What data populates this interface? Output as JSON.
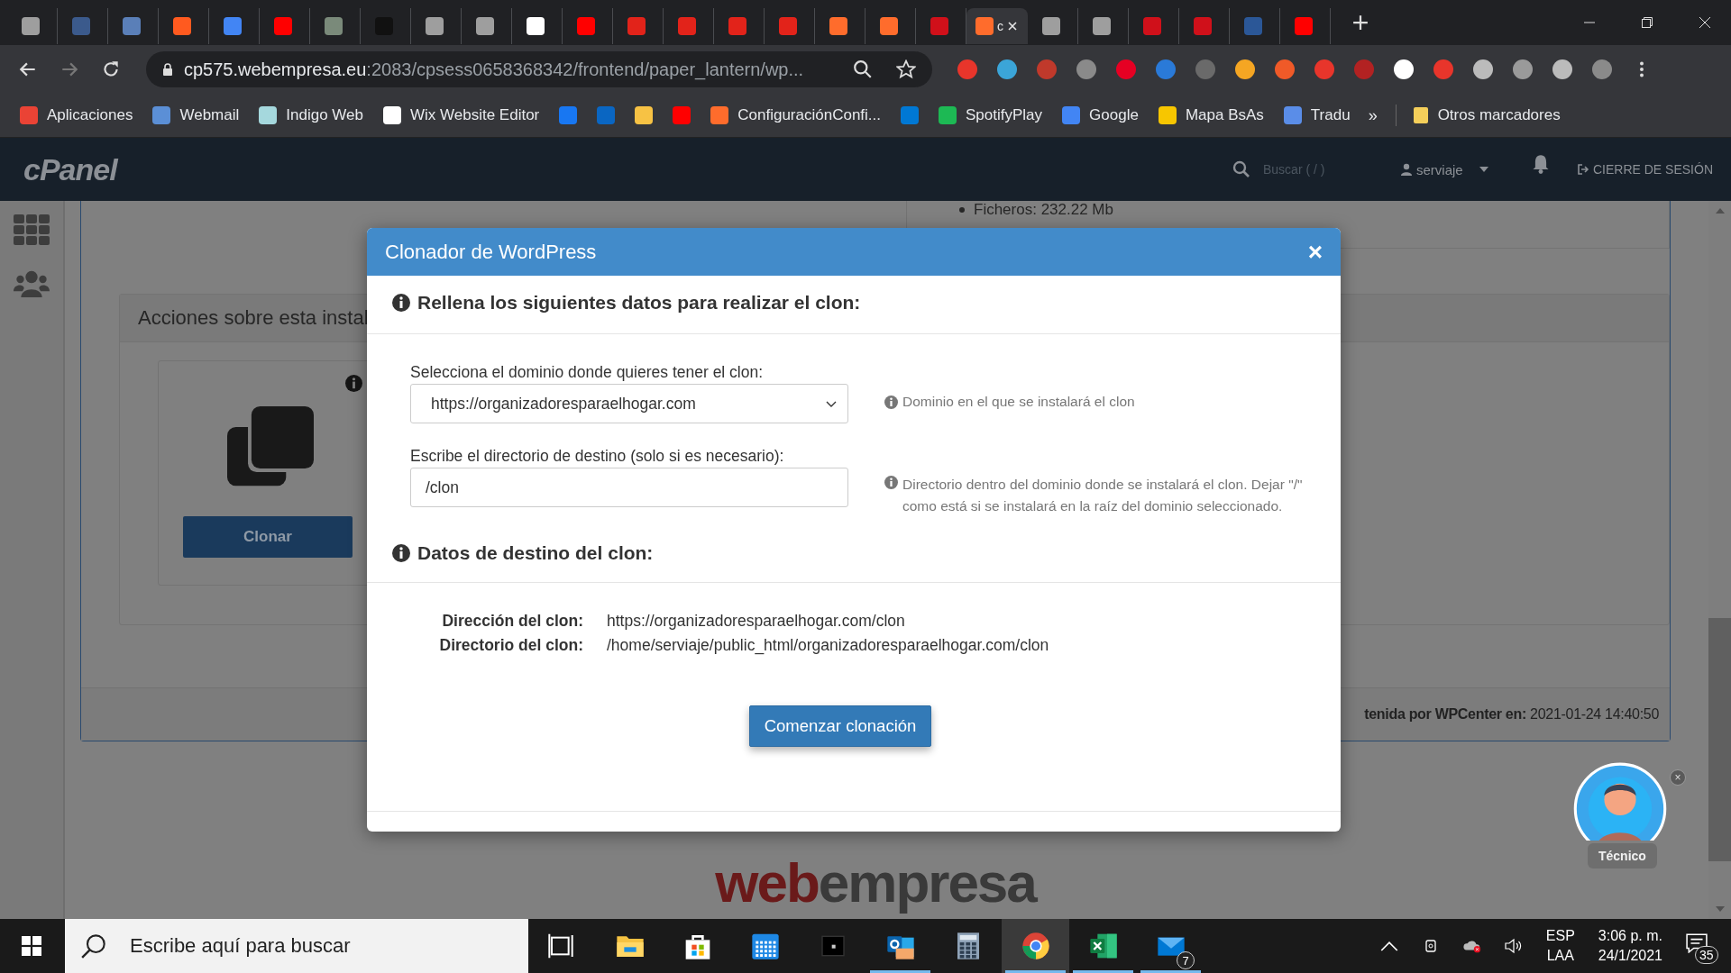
{
  "browser": {
    "tabs": [
      {
        "selected": false,
        "color": "#9e9e9e"
      },
      {
        "selected": false,
        "color": "#3b5a8c"
      },
      {
        "selected": false,
        "color": "#5a7fb8"
      },
      {
        "selected": false,
        "color": "#ff5a1f"
      },
      {
        "selected": false,
        "color": "#4285f4"
      },
      {
        "selected": false,
        "color": "#ff0000"
      },
      {
        "selected": false,
        "color": "#7a8a7a"
      },
      {
        "selected": false,
        "color": "#111111"
      },
      {
        "selected": false,
        "color": "#9e9e9e"
      },
      {
        "selected": false,
        "color": "#9e9e9e"
      },
      {
        "selected": false,
        "color": "#ffffff"
      },
      {
        "selected": false,
        "color": "#ff0000"
      },
      {
        "selected": false,
        "color": "#e2231a"
      },
      {
        "selected": false,
        "color": "#e2231a"
      },
      {
        "selected": false,
        "color": "#e2231a"
      },
      {
        "selected": false,
        "color": "#e2231a"
      },
      {
        "selected": false,
        "color": "#ff6c2c"
      },
      {
        "selected": false,
        "color": "#ff6c2c"
      },
      {
        "selected": false,
        "color": "#d0101a"
      },
      {
        "selected": true,
        "color": "#ff6c2c",
        "label": "c"
      },
      {
        "selected": false,
        "color": "#9e9e9e"
      },
      {
        "selected": false,
        "color": "#9e9e9e"
      },
      {
        "selected": false,
        "color": "#d0101a"
      },
      {
        "selected": false,
        "color": "#d0101a"
      },
      {
        "selected": false,
        "color": "#2b5797"
      },
      {
        "selected": false,
        "color": "#ff0000"
      }
    ],
    "url_host": "cp575.webempresa.eu",
    "url_rest": ":2083/cpsess0658368342/frontend/paper_lantern/wp...",
    "extensions": [
      {
        "color": "#e8352b"
      },
      {
        "color": "#3ba5d8"
      },
      {
        "color": "#c0392b"
      },
      {
        "color": "#8a8a8a"
      },
      {
        "color": "#e60023"
      },
      {
        "color": "#2a7ad8"
      },
      {
        "color": "#6a6a6a"
      },
      {
        "color": "#f5a623"
      },
      {
        "color": "#f05a28"
      },
      {
        "color": "#e8352b"
      },
      {
        "color": "#b22222"
      },
      {
        "color": "#ffffff"
      },
      {
        "color": "#e8352b"
      },
      {
        "color": "#bbbbbb"
      },
      {
        "color": "#9a9a9a"
      },
      {
        "color": "#bbbbbb"
      },
      {
        "color": "#8a8a8a"
      }
    ],
    "bookmarks": [
      {
        "label": "Aplicaciones",
        "color": "#ea4335"
      },
      {
        "label": "Webmail",
        "color": "#5b8fd6"
      },
      {
        "label": "Indigo Web",
        "color": "#a5d8dd"
      },
      {
        "label": "Wix Website Editor",
        "color": "#ffffff"
      },
      {
        "color": "#1877f2"
      },
      {
        "color": "#0a66c2"
      },
      {
        "color": "#f7c244"
      },
      {
        "color": "#ff0000"
      },
      {
        "label": "ConfiguraciónConfi...",
        "color": "#ff6c2c"
      },
      {
        "color": "#0078d4"
      },
      {
        "label": "SpotifyPlay",
        "color": "#1db954"
      },
      {
        "label": "Google",
        "color": "#4285f4"
      },
      {
        "label": "Mapa BsAs",
        "color": "#f7c600"
      },
      {
        "label": "Tradu",
        "color": "#5a8de8"
      }
    ],
    "more": "»",
    "other_bookmarks": "Otros marcadores"
  },
  "cpanel": {
    "logo": "cPanel",
    "search_placeholder": "Buscar ( / )",
    "user": "serviaje",
    "logout": "CIERRE DE SESIÓN"
  },
  "page": {
    "files_item": "Ficheros: 232.22 Mb",
    "actions_title": "Acciones sobre esta instal",
    "clone_button": "Clonar",
    "footer_label": "tenida por WPCenter en:",
    "footer_value": "2021-01-24 14:40:50",
    "logo_part1": "web",
    "logo_part2": "empresa",
    "assistant_label": "Técnico"
  },
  "modal": {
    "title": "Clonador de WordPress",
    "close": "×",
    "section1": "Rellena los siguientes datos para realizar el clon:",
    "domain_label": "Selecciona el dominio donde quieres tener el clon:",
    "domain_value": "https://organizadoresparaelhogar.com",
    "domain_hint": "Dominio en el que se instalará el clon",
    "dir_label": "Escribe el directorio de destino (solo si es necesario):",
    "dir_value": "/clon",
    "dir_hint": "Directorio dentro del dominio donde se instalará el clon. Dejar \"/\" como está si se instalará en la raíz del dominio seleccionado.",
    "section2": "Datos de destino del clon:",
    "details": [
      {
        "label": "Dirección del clon:",
        "value": "https://organizadoresparaelhogar.com/clon"
      },
      {
        "label": "Directorio del clon:",
        "value": "/home/serviaje/public_html/organizadoresparaelhogar.com/clon"
      }
    ],
    "start_button": "Comenzar clonación"
  },
  "taskbar": {
    "search_placeholder": "Escribe aquí para buscar",
    "apps": [
      {
        "kind": "taskview",
        "running": false,
        "selected": false
      },
      {
        "kind": "explorer",
        "running": false,
        "selected": false
      },
      {
        "kind": "store",
        "running": false,
        "selected": false
      },
      {
        "kind": "calendar",
        "running": false,
        "selected": false
      },
      {
        "kind": "terminal",
        "running": false,
        "selected": false
      },
      {
        "kind": "outlook",
        "running": true,
        "selected": false
      },
      {
        "kind": "calculator",
        "running": false,
        "selected": false
      },
      {
        "kind": "chrome",
        "running": true,
        "selected": true
      },
      {
        "kind": "excel",
        "running": true,
        "selected": false
      },
      {
        "kind": "mail",
        "running": true,
        "selected": false,
        "badge": "7"
      }
    ],
    "lang": "ESP",
    "layout": "LAA",
    "time": "3:06 p. m.",
    "date": "24/1/2021",
    "notifications": "35"
  }
}
